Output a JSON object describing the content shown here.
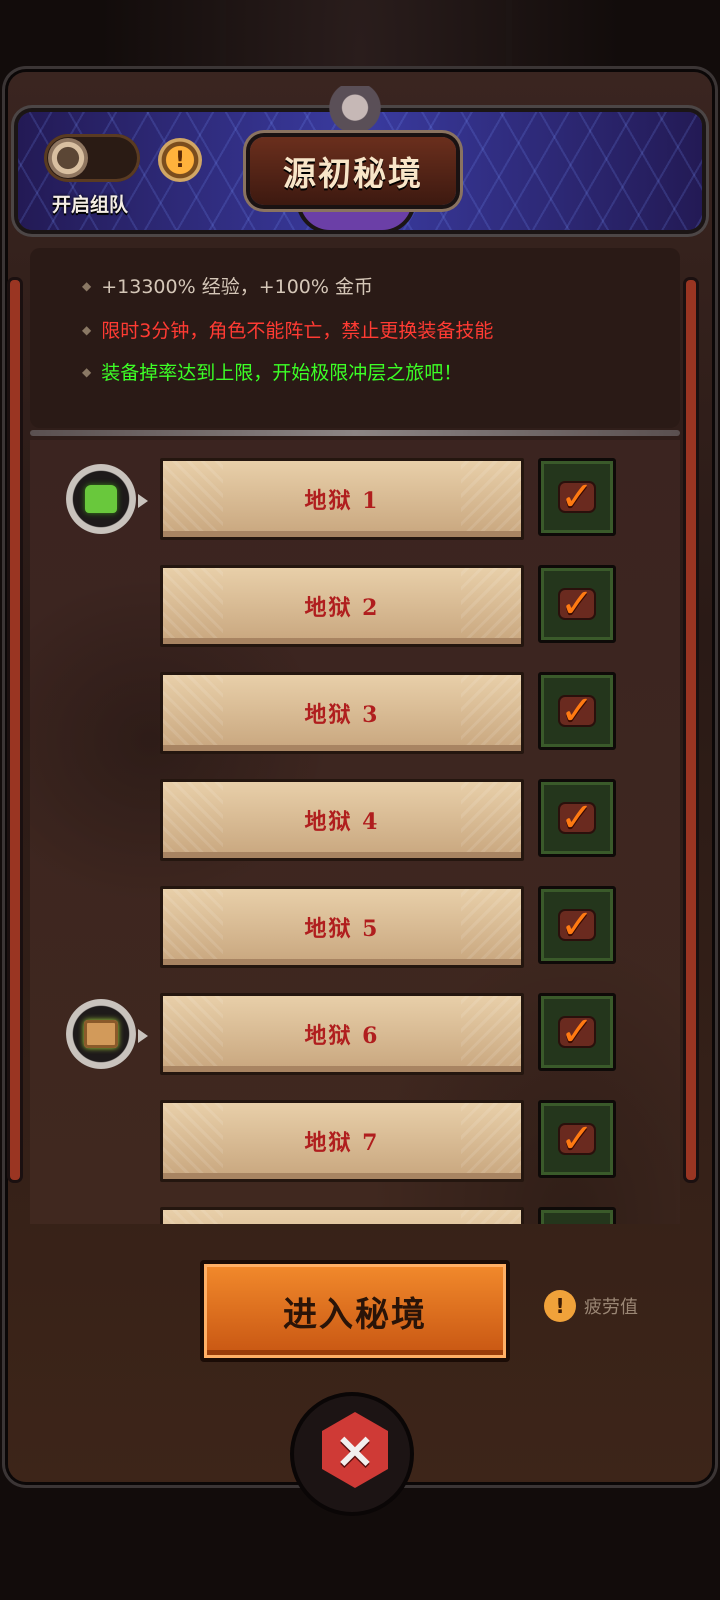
{
  "header": {
    "team_toggle_label": "开启组队",
    "info_badge": "!",
    "title": "源初秘境"
  },
  "rules": [
    "+13300% 经验，+100% 金币",
    "限时3分钟，角色不能阵亡，禁止更换装备技能",
    "装备掉率达到上限，开始极限冲层之旅吧！"
  ],
  "floors": [
    {
      "label": "地狱 1",
      "cleared": true,
      "reward_icon": "shirt-icon"
    },
    {
      "label": "地狱 2",
      "cleared": true
    },
    {
      "label": "地狱 3",
      "cleared": true
    },
    {
      "label": "地狱 4",
      "cleared": true
    },
    {
      "label": "地狱 5",
      "cleared": true
    },
    {
      "label": "地狱 6",
      "cleared": true,
      "reward_icon": "scroll-icon"
    },
    {
      "label": "地狱 7",
      "cleared": true
    }
  ],
  "footer": {
    "enter_button": "进入秘境",
    "fatigue_icon": "!",
    "fatigue_label": "疲劳值",
    "close_icon": "×"
  },
  "colors": {
    "rule_exp": "#d4c6b7",
    "rule_warning": "#ff3b33",
    "rule_tip": "#3cff26",
    "floor_text": "#b01e1e",
    "enter_button": "#e0731f"
  }
}
